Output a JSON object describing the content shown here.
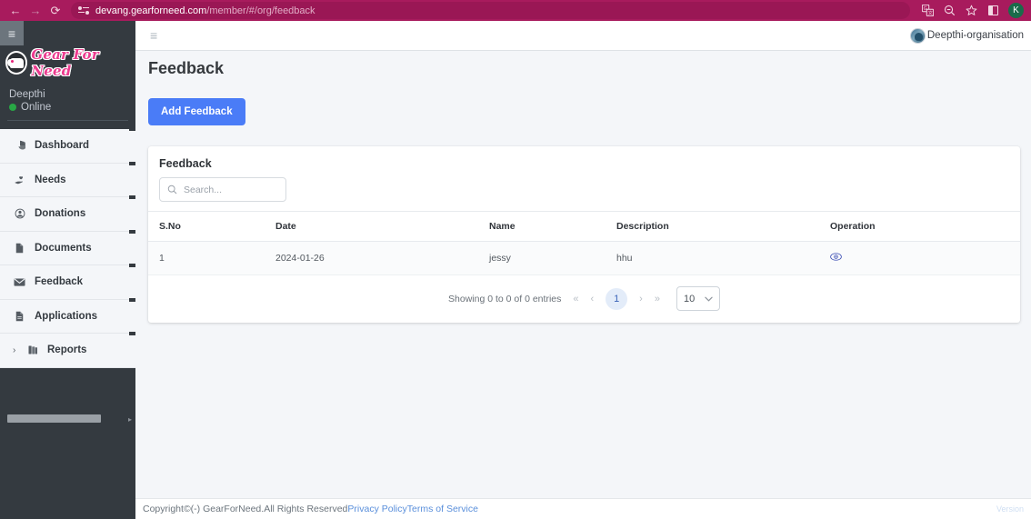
{
  "browser": {
    "back_icon": "←",
    "forward_icon": "→",
    "reload_icon": "⟳",
    "site_icon": "site-settings-icon",
    "url_domain": "devang.gearforneed.com",
    "url_path": "/member/#/org/feedback",
    "translate_icon": "translate-icon",
    "zoom_icon": "zoom-out-icon",
    "bookmark_icon": "★",
    "split_icon": "split-screen-icon",
    "profile_initial": "K"
  },
  "sidebar": {
    "hamburger_icon": "≡",
    "brand": "Gear For Need",
    "brand_badge_icon": "elephant-logo-icon",
    "user_name": "Deepthi",
    "user_status": "Online",
    "status_color": "#28a745",
    "items": [
      {
        "label": "Dashboard",
        "icon": "◕",
        "name": "dashboard",
        "chevron": ""
      },
      {
        "label": "Needs",
        "icon": "⚕",
        "name": "needs",
        "chevron": ""
      },
      {
        "label": "Donations",
        "icon": "☻",
        "name": "donations",
        "chevron": ""
      },
      {
        "label": "Documents",
        "icon": "▤",
        "name": "documents",
        "chevron": ""
      },
      {
        "label": "Feedback",
        "icon": "✉",
        "name": "feedback",
        "chevron": ""
      },
      {
        "label": "Applications",
        "icon": "▤",
        "name": "applications",
        "chevron": ""
      },
      {
        "label": "Reports",
        "icon": "▥",
        "name": "reports",
        "chevron": "›"
      }
    ]
  },
  "topnav": {
    "hamburger_icon": "≡",
    "org_name": "Deepthi-organisation",
    "org_avatar_icon": "user-avatar"
  },
  "page": {
    "title": "Feedback",
    "add_button": "Add Feedback"
  },
  "card": {
    "title": "Feedback",
    "search_placeholder": "Search...",
    "search_value": "",
    "search_icon": "search-icon",
    "columns": [
      "S.No",
      "Date",
      "Name",
      "Description",
      "Operation"
    ],
    "rows": [
      {
        "sno": "1",
        "date": "2024-01-26",
        "name": "jessy",
        "description": "hhu",
        "operation_icon": "eye-icon"
      }
    ]
  },
  "pagination": {
    "info": "Showing 0 to 0 of 0 entries",
    "first_icon": "«",
    "prev_icon": "‹",
    "pages": [
      "1"
    ],
    "current_page": "1",
    "next_icon": "›",
    "last_icon": "»",
    "page_size": "10",
    "page_size_chevron": "⌄"
  },
  "footer": {
    "copyright": "Copyright©(-) GearForNeed.All Rights Reserved",
    "privacy_link": "Privacy Policy",
    "terms_link": "Terms of Service",
    "version": "Version"
  },
  "colors": {
    "browser_chrome": "#a81b5d",
    "sidebar_bg": "#343a40",
    "accent_button": "#4a7cf7",
    "brand_pink": "#ec3b8f",
    "link_blue": "#5a8fdb"
  }
}
